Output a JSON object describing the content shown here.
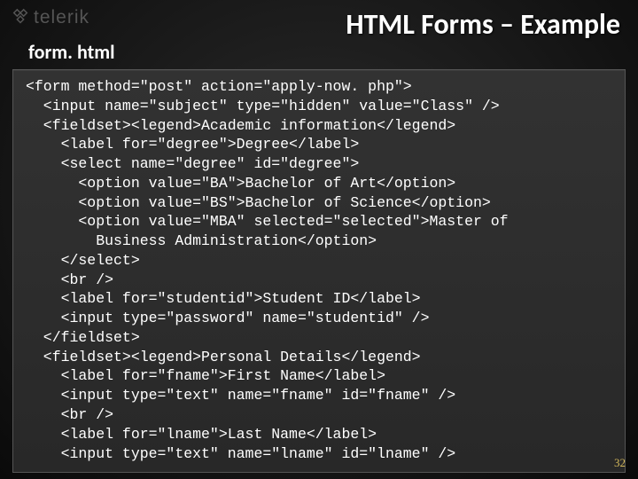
{
  "brand": "telerik",
  "title": "HTML Forms – Example",
  "filename": "form. html",
  "code": "<form method=\"post\" action=\"apply-now. php\">\n  <input name=\"subject\" type=\"hidden\" value=\"Class\" />\n  <fieldset><legend>Academic information</legend>\n    <label for=\"degree\">Degree</label>\n    <select name=\"degree\" id=\"degree\">\n      <option value=\"BA\">Bachelor of Art</option>\n      <option value=\"BS\">Bachelor of Science</option>\n      <option value=\"MBA\" selected=\"selected\">Master of\n        Business Administration</option>\n    </select>\n    <br />\n    <label for=\"studentid\">Student ID</label>\n    <input type=\"password\" name=\"studentid\" />\n  </fieldset>\n  <fieldset><legend>Personal Details</legend>\n    <label for=\"fname\">First Name</label>\n    <input type=\"text\" name=\"fname\" id=\"fname\" />\n    <br />\n    <label for=\"lname\">Last Name</label>\n    <input type=\"text\" name=\"lname\" id=\"lname\" />",
  "page_number": "32"
}
